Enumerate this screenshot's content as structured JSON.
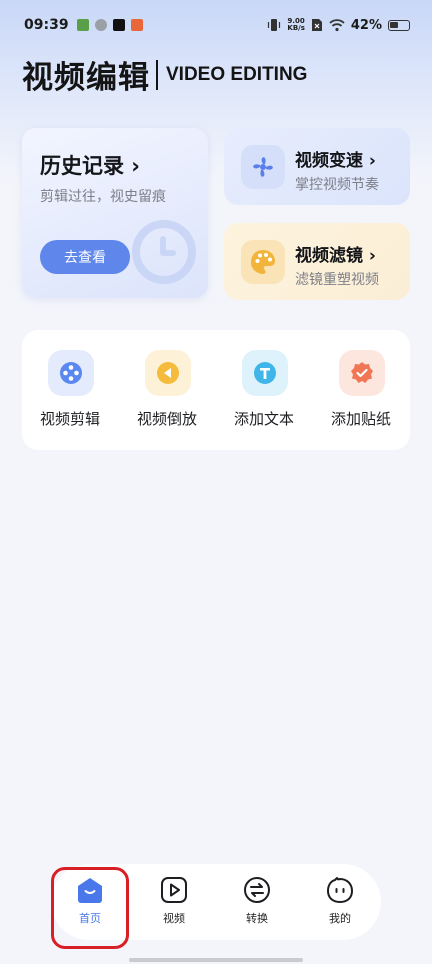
{
  "status_bar": {
    "time": "09:39",
    "net_speed_value": "9.00",
    "net_speed_unit": "KB/s",
    "battery": "42%"
  },
  "header": {
    "title_cn": "视频编辑",
    "title_en": "VIDEO EDITING"
  },
  "history": {
    "title": "历史记录 ›",
    "subtitle": "剪辑过往，视史留痕",
    "button": "去查看"
  },
  "speed_card": {
    "title": "视频变速 ›",
    "subtitle": "掌控视频节奏",
    "icon": "fan-icon"
  },
  "filter_card": {
    "title": "视频滤镜 ›",
    "subtitle": "滤镜重塑视频",
    "icon": "palette-icon"
  },
  "tools": [
    {
      "label": "视频剪辑",
      "icon": "film-reel-icon",
      "color": "#5b87f0"
    },
    {
      "label": "视频倒放",
      "icon": "rewind-icon",
      "color": "#f5bb3d"
    },
    {
      "label": "添加文本",
      "icon": "text-icon",
      "color": "#3fb5ea"
    },
    {
      "label": "添加贴纸",
      "icon": "sticker-icon",
      "color": "#f07655"
    }
  ],
  "nav": [
    {
      "label": "首页",
      "icon": "home-icon",
      "active": true
    },
    {
      "label": "视频",
      "icon": "play-icon",
      "active": false
    },
    {
      "label": "转换",
      "icon": "convert-icon",
      "active": false
    },
    {
      "label": "我的",
      "icon": "profile-icon",
      "active": false
    }
  ],
  "colors": {
    "accent": "#5f86ea",
    "highlight": "#d91f26"
  }
}
